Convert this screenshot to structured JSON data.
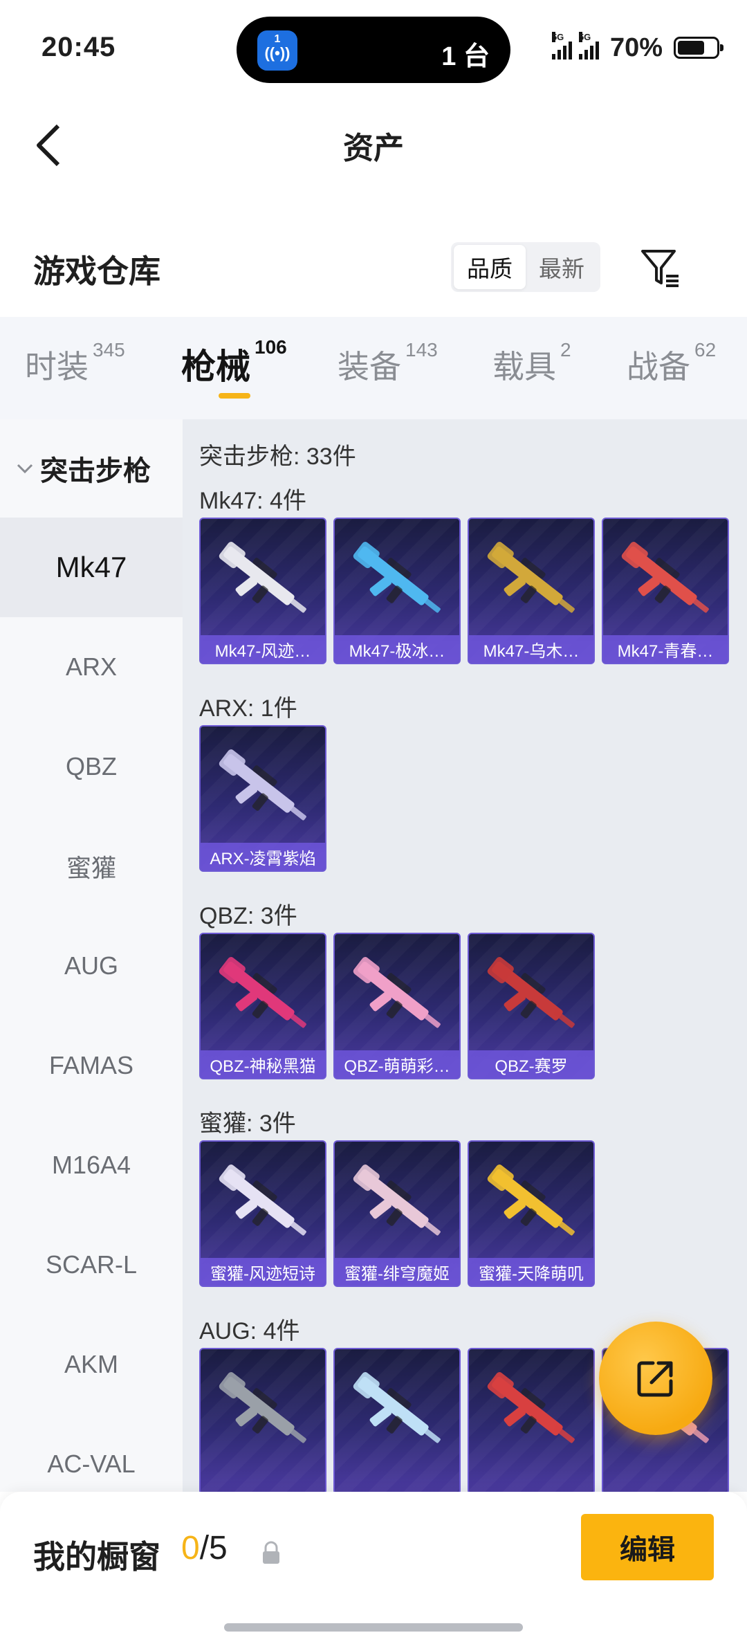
{
  "status_bar": {
    "time": "20:45",
    "island_app_num": "1",
    "island_count": "1 台",
    "signal_1": "5G",
    "signal_2": "5G",
    "battery_pct": "70%",
    "battery_level": 0.7
  },
  "header": {
    "title": "资产"
  },
  "warehouse": {
    "title": "游戏仓库",
    "sort_options": [
      "品质",
      "最新"
    ],
    "sort_active": "品质"
  },
  "tabs": [
    {
      "label": "时装",
      "count": "345"
    },
    {
      "label": "枪械",
      "count": "106"
    },
    {
      "label": "装备",
      "count": "143"
    },
    {
      "label": "载具",
      "count": "2"
    },
    {
      "label": "战备",
      "count": "62"
    }
  ],
  "active_tab": "枪械",
  "sidebar": {
    "category": "突击步枪",
    "items": [
      "Mk47",
      "ARX",
      "QBZ",
      "蜜獾",
      "AUG",
      "FAMAS",
      "M16A4",
      "SCAR-L",
      "AKM",
      "AC-VAL"
    ],
    "active": "Mk47"
  },
  "content": {
    "summary": "突击步枪: 33件",
    "groups": [
      {
        "title": "Mk47: 4件",
        "items": [
          {
            "label": "Mk47-风迹…",
            "color": "#e8e8ee"
          },
          {
            "label": "Mk47-极冰…",
            "color": "#4fb8f0"
          },
          {
            "label": "Mk47-乌木…",
            "color": "#d2a83a"
          },
          {
            "label": "Mk47-青春…",
            "color": "#e0504a"
          }
        ]
      },
      {
        "title": "ARX: 1件",
        "items": [
          {
            "label": "ARX-凌霄紫焰",
            "color": "#c8c4ea"
          }
        ]
      },
      {
        "title": "QBZ: 3件",
        "items": [
          {
            "label": "QBZ-神秘黑猫",
            "color": "#e0387a"
          },
          {
            "label": "QBZ-萌萌彩…",
            "color": "#f0a0c8"
          },
          {
            "label": "QBZ-赛罗",
            "color": "#c83a3a"
          }
        ]
      },
      {
        "title": "蜜獾: 3件",
        "items": [
          {
            "label": "蜜獾-风迹短诗",
            "color": "#e6e2f4"
          },
          {
            "label": "蜜獾-绯穹魔姬",
            "color": "#e8c8d8"
          },
          {
            "label": "蜜獾-天降萌叽",
            "color": "#f2c030"
          }
        ]
      },
      {
        "title": "AUG: 4件",
        "items": [
          {
            "label": "",
            "color": "#9aa0a8"
          },
          {
            "label": "",
            "color": "#bfe0f6"
          },
          {
            "label": "",
            "color": "#d84040"
          },
          {
            "label": "",
            "color": "#e89ab0"
          }
        ]
      }
    ]
  },
  "bottom": {
    "title": "我的橱窗",
    "used": "0",
    "total": "/5",
    "edit_label": "编辑"
  }
}
